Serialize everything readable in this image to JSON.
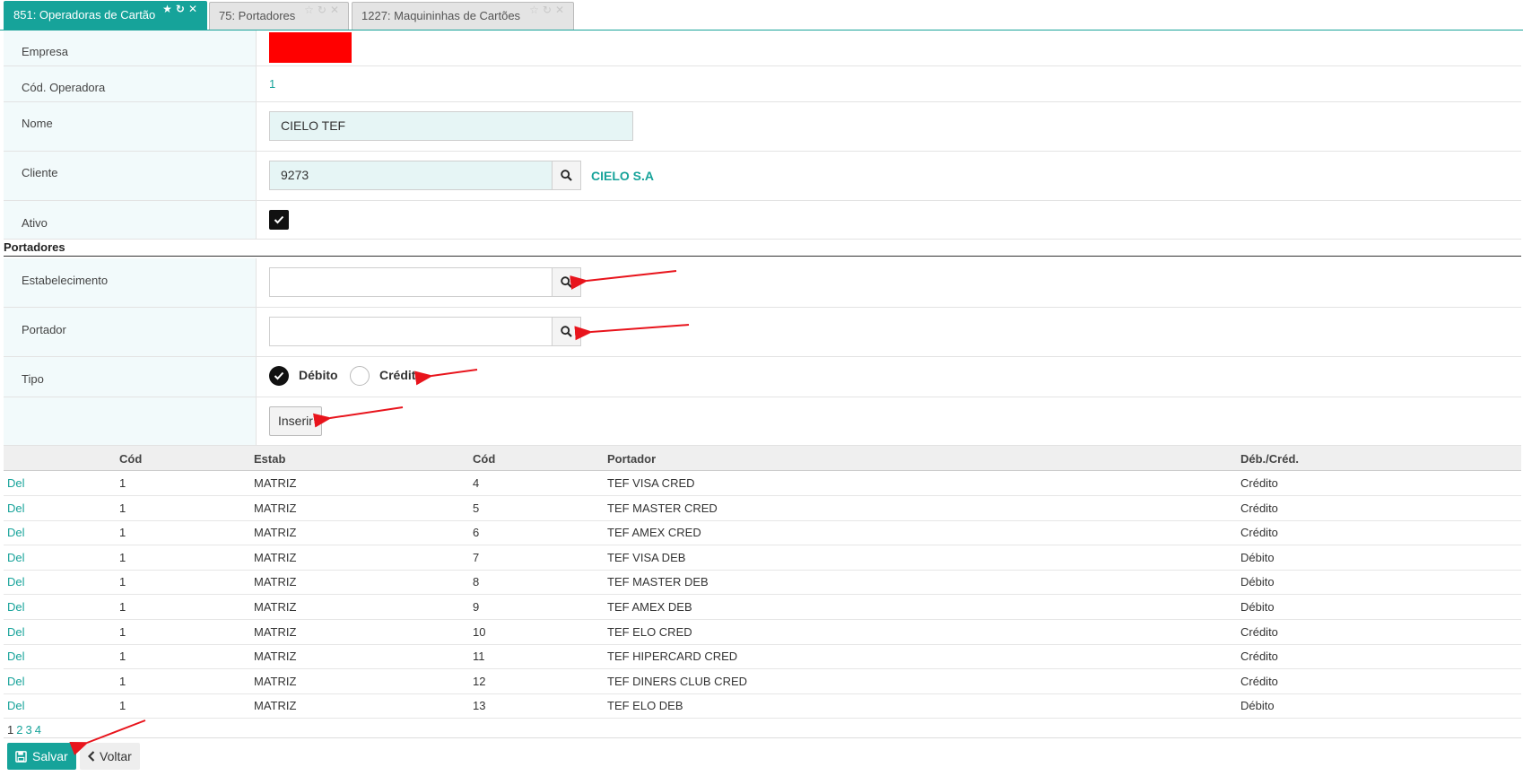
{
  "tabs": [
    {
      "label": "851: Operadoras de Cartão",
      "active": true
    },
    {
      "label": "75: Portadores",
      "active": false
    },
    {
      "label": "1227: Maquininhas de Cartões",
      "active": false
    }
  ],
  "form": {
    "empresa_label": "Empresa",
    "cod_operadora_label": "Cód. Operadora",
    "cod_operadora_value": "1",
    "nome_label": "Nome",
    "nome_value": "CIELO TEF",
    "cliente_label": "Cliente",
    "cliente_value": "9273",
    "cliente_name": "CIELO S.A",
    "ativo_label": "Ativo",
    "ativo_checked": true
  },
  "portadores": {
    "section_title": "Portadores",
    "estab_label": "Estabelecimento",
    "estab_value": "",
    "portador_label": "Portador",
    "portador_value": "",
    "tipo_label": "Tipo",
    "tipo_options": [
      "Débito",
      "Crédito"
    ],
    "tipo_selected": "Débito",
    "insert_label": "Inserir"
  },
  "table": {
    "headers": [
      "",
      "Cód",
      "Estab",
      "Cód",
      "Portador",
      "Déb./Créd."
    ],
    "rows": [
      [
        "Del",
        "1",
        "MATRIZ",
        "4",
        "TEF VISA CRED",
        "Crédito"
      ],
      [
        "Del",
        "1",
        "MATRIZ",
        "5",
        "TEF MASTER CRED",
        "Crédito"
      ],
      [
        "Del",
        "1",
        "MATRIZ",
        "6",
        "TEF AMEX CRED",
        "Crédito"
      ],
      [
        "Del",
        "1",
        "MATRIZ",
        "7",
        "TEF VISA DEB",
        "Débito"
      ],
      [
        "Del",
        "1",
        "MATRIZ",
        "8",
        "TEF MASTER DEB",
        "Débito"
      ],
      [
        "Del",
        "1",
        "MATRIZ",
        "9",
        "TEF AMEX DEB",
        "Débito"
      ],
      [
        "Del",
        "1",
        "MATRIZ",
        "10",
        "TEF ELO CRED",
        "Crédito"
      ],
      [
        "Del",
        "1",
        "MATRIZ",
        "11",
        "TEF HIPERCARD CRED",
        "Crédito"
      ],
      [
        "Del",
        "1",
        "MATRIZ",
        "12",
        "TEF DINERS CLUB CRED",
        "Crédito"
      ],
      [
        "Del",
        "1",
        "MATRIZ",
        "13",
        "TEF ELO DEB",
        "Débito"
      ]
    ]
  },
  "pagination": {
    "current": "1",
    "pages": [
      "2",
      "3",
      "4"
    ]
  },
  "footer": {
    "save_label": "Salvar",
    "back_label": "Voltar"
  },
  "colors": {
    "accent": "#16a39a",
    "annotation": "#e8141c"
  }
}
